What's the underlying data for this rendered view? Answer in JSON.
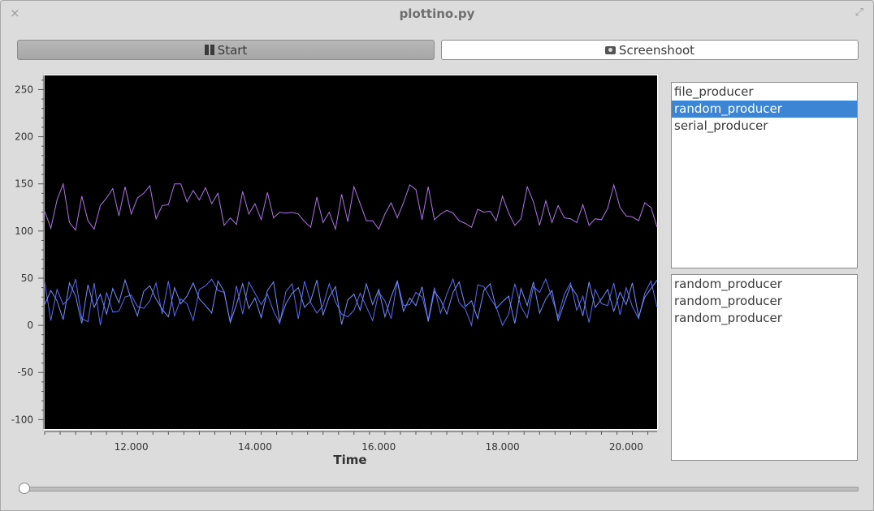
{
  "window": {
    "title": "plottino.py",
    "close_icon": "×",
    "maximize_icon": "⤢"
  },
  "toolbar": {
    "start_label": "Start",
    "screenshot_label": "Screenshoot"
  },
  "producers": {
    "items": [
      "file_producer",
      "random_producer",
      "serial_producer"
    ],
    "selected_index": 1
  },
  "active_producers": {
    "items": [
      "random_producer",
      "random_producer",
      "random_producer"
    ]
  },
  "slider": {
    "value": 0
  },
  "chart_data": {
    "type": "line",
    "title": "",
    "xlabel": "Time",
    "ylabel": "",
    "xlim": [
      10.6,
      20.5
    ],
    "ylim": [
      -110,
      265
    ],
    "xticks": [
      "12.000",
      "14.000",
      "16.000",
      "18.000",
      "20.000"
    ],
    "xtick_values": [
      12,
      14,
      16,
      18,
      20
    ],
    "yticks": [
      "250",
      "200",
      "150",
      "100",
      "50",
      "0",
      "-50",
      "-100"
    ],
    "ytick_values": [
      250,
      200,
      150,
      100,
      50,
      0,
      -50,
      -100
    ],
    "background": "#000000",
    "colors": [
      "#b070e8",
      "#5a6af0",
      "#7090ff"
    ],
    "x": [
      10.6,
      10.7,
      10.8,
      10.9,
      11.0,
      11.1,
      11.2,
      11.3,
      11.4,
      11.5,
      11.6,
      11.7,
      11.8,
      11.9,
      12.0,
      12.1,
      12.2,
      12.3,
      12.4,
      12.5,
      12.6,
      12.7,
      12.8,
      12.9,
      13.0,
      13.1,
      13.2,
      13.3,
      13.4,
      13.5,
      13.6,
      13.7,
      13.8,
      13.9,
      14.0,
      14.1,
      14.2,
      14.3,
      14.4,
      14.5,
      14.6,
      14.7,
      14.8,
      14.9,
      15.0,
      15.1,
      15.2,
      15.3,
      15.4,
      15.5,
      15.6,
      15.7,
      15.8,
      15.9,
      16.0,
      16.1,
      16.2,
      16.3,
      16.4,
      16.5,
      16.6,
      16.7,
      16.8,
      16.9,
      17.0,
      17.1,
      17.2,
      17.3,
      17.4,
      17.5,
      17.6,
      17.7,
      17.8,
      17.9,
      18.0,
      18.1,
      18.2,
      18.3,
      18.4,
      18.5,
      18.6,
      18.7,
      18.8,
      18.9,
      19.0,
      19.1,
      19.2,
      19.3,
      19.4,
      19.5,
      19.6,
      19.7,
      19.8,
      19.9,
      20.0,
      20.1,
      20.2,
      20.3,
      20.4,
      20.5
    ],
    "series": [
      {
        "values": [
          121,
          103,
          133,
          150,
          109,
          101,
          137,
          111,
          102,
          127,
          135,
          145,
          116,
          147,
          118,
          135,
          140,
          148,
          113,
          127,
          128,
          150,
          150,
          131,
          143,
          133,
          146,
          129,
          140,
          106,
          114,
          107,
          142,
          118,
          129,
          112,
          141,
          114,
          120,
          119,
          120,
          118,
          110,
          104,
          136,
          109,
          120,
          102,
          139,
          110,
          147,
          129,
          111,
          111,
          102,
          118,
          130,
          114,
          130,
          149,
          144,
          112,
          147,
          112,
          118,
          122,
          119,
          111,
          108,
          104,
          123,
          120,
          121,
          111,
          137,
          119,
          106,
          113,
          147,
          131,
          106,
          132,
          109,
          127,
          114,
          113,
          109,
          128,
          106,
          113,
          112,
          124,
          149,
          125,
          116,
          115,
          111,
          130,
          125,
          104
        ]
      },
      {
        "values": [
          46,
          5,
          38,
          22,
          29,
          49,
          7,
          4,
          45,
          0,
          35,
          14,
          15,
          30,
          32,
          20,
          18,
          26,
          45,
          12,
          47,
          10,
          28,
          23,
          5,
          38,
          42,
          49,
          37,
          35,
          3,
          42,
          12,
          46,
          34,
          22,
          33,
          15,
          2,
          36,
          44,
          7,
          47,
          24,
          13,
          21,
          44,
          25,
          12,
          9,
          16,
          34,
          20,
          5,
          35,
          26,
          7,
          47,
          21,
          22,
          35,
          30,
          6,
          40,
          13,
          33,
          49,
          24,
          17,
          0,
          43,
          41,
          29,
          19,
          0,
          12,
          44,
          20,
          8,
          41,
          35,
          49,
          29,
          9,
          33,
          45,
          16,
          31,
          3,
          38,
          23,
          21,
          45,
          11,
          40,
          20,
          7,
          34,
          47,
          19
        ]
      },
      {
        "values": [
          22,
          37,
          26,
          6,
          45,
          31,
          2,
          43,
          19,
          33,
          12,
          39,
          24,
          48,
          27,
          10,
          36,
          42,
          28,
          17,
          9,
          40,
          23,
          31,
          45,
          28,
          21,
          13,
          47,
          36,
          3,
          22,
          44,
          18,
          29,
          8,
          37,
          46,
          4,
          23,
          34,
          40,
          19,
          26,
          48,
          11,
          30,
          41,
          1,
          27,
          33,
          16,
          44,
          22,
          38,
          9,
          30,
          47,
          15,
          29,
          21,
          41,
          4,
          36,
          27,
          12,
          35,
          46,
          20,
          26,
          7,
          37,
          44,
          18,
          25,
          31,
          2,
          39,
          21,
          46,
          13,
          28,
          37,
          5,
          24,
          42,
          32,
          10,
          46,
          19,
          28,
          38,
          15,
          35,
          22,
          45,
          9,
          30,
          39,
          48
        ]
      }
    ]
  }
}
